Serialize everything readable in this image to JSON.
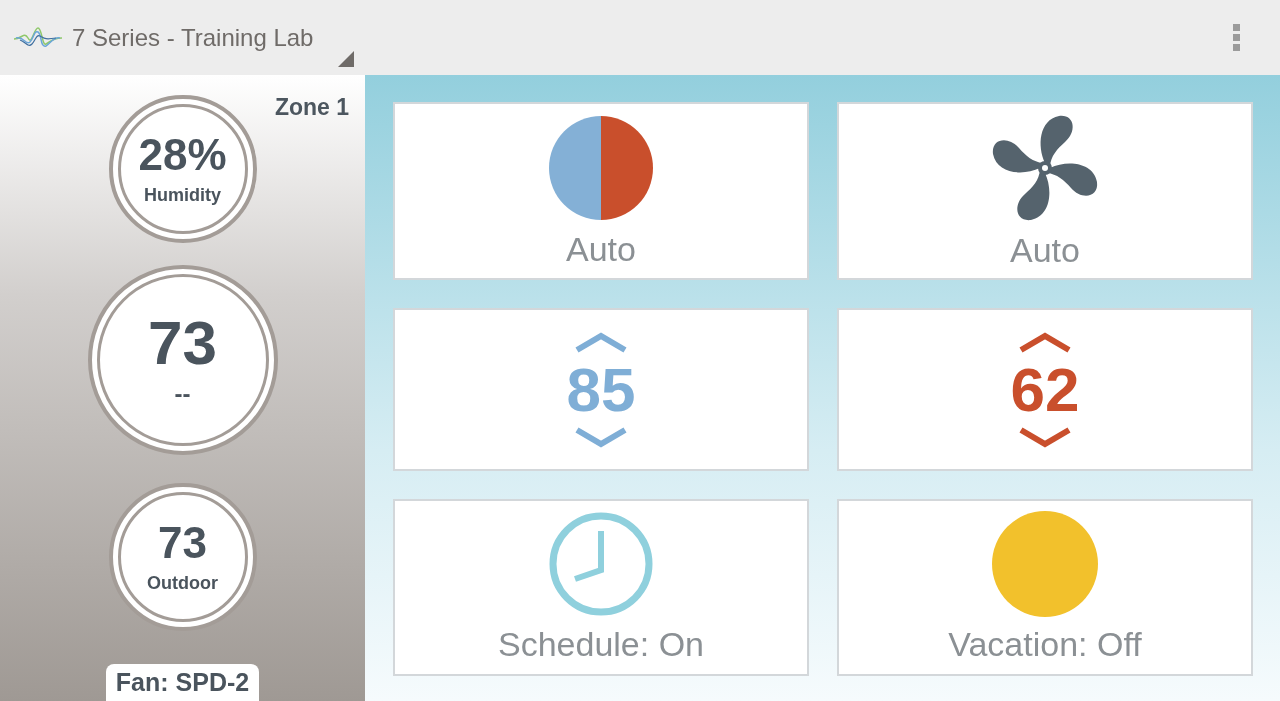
{
  "header": {
    "title": "7 Series - Training Lab"
  },
  "zone": {
    "label": "Zone 1"
  },
  "readings": [
    {
      "kind": "small",
      "value": "28%",
      "label": "Humidity"
    },
    {
      "kind": "large",
      "value": "73",
      "label": "--"
    },
    {
      "kind": "small",
      "value": "73",
      "label": "Outdoor"
    }
  ],
  "fan_status": "Fan: SPD-2",
  "tiles": [
    {
      "kind": "mode",
      "label": "Auto"
    },
    {
      "kind": "fan",
      "label": "Auto"
    },
    {
      "kind": "setpoint",
      "value": "85",
      "color": "#7faed6"
    },
    {
      "kind": "setpoint",
      "value": "62",
      "color": "#c94f2c"
    },
    {
      "kind": "schedule",
      "label": "Schedule: On"
    },
    {
      "kind": "vacation",
      "label": "Vacation: Off"
    }
  ]
}
